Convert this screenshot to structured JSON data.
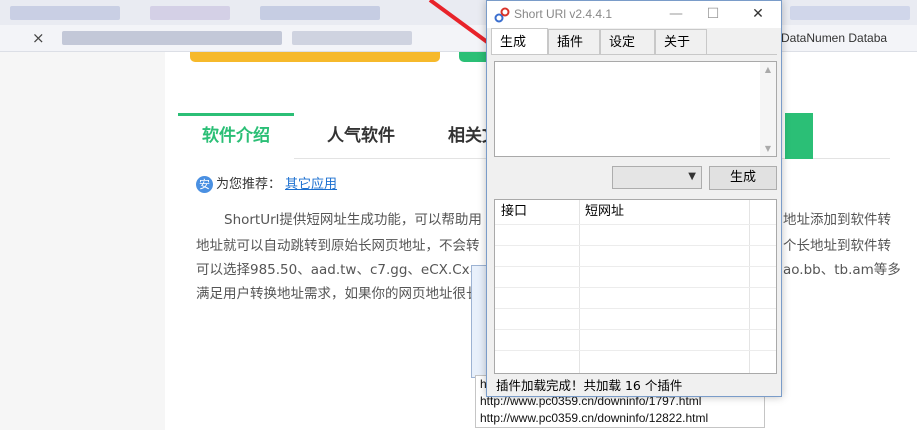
{
  "browser": {
    "tab_close": "×",
    "right_tab_label": "DataNumen Databa"
  },
  "page": {
    "tabs": [
      "软件介绍",
      "人气软件",
      "相关文"
    ],
    "recommend_badge": "安",
    "recommend_label": "为您推荐：",
    "recommend_link": "其它应用",
    "para_lines": [
      "ShortUrl提供短网址生成功能，可以帮助用",
      "地址就可以自动跳转到原始长网页地址，不会转",
      "可以选择985.50、aad.tw、c7.gg、eCX.Cx、ex",
      "满足用户转换地址需求，如果你的网页地址很长"
    ],
    "para_right_lines": [
      "地址添加到软件转",
      "个长地址到软件转",
      "ao.bb、tb.am等多",
      ""
    ],
    "bottom_list": [
      "ht",
      "http://www.pc0359.cn/downinfo/1797.html",
      "http://www.pc0359.cn/downinfo/12822.html"
    ]
  },
  "app": {
    "title": "Short URl v2.4.4.1",
    "minimize": "—",
    "maximize": "☐",
    "close": "✕",
    "tabs": [
      "生成",
      "插件",
      "设定",
      "关于"
    ],
    "combo_value": "",
    "generate_button": "生成",
    "columns": [
      "接口",
      "短网址"
    ],
    "status": "插件加载完成！共加载 16 个插件"
  },
  "colors": {
    "accent_green": "#2bbf76",
    "accent_orange": "#f6b92b",
    "arrow_red": "#e8232a"
  }
}
